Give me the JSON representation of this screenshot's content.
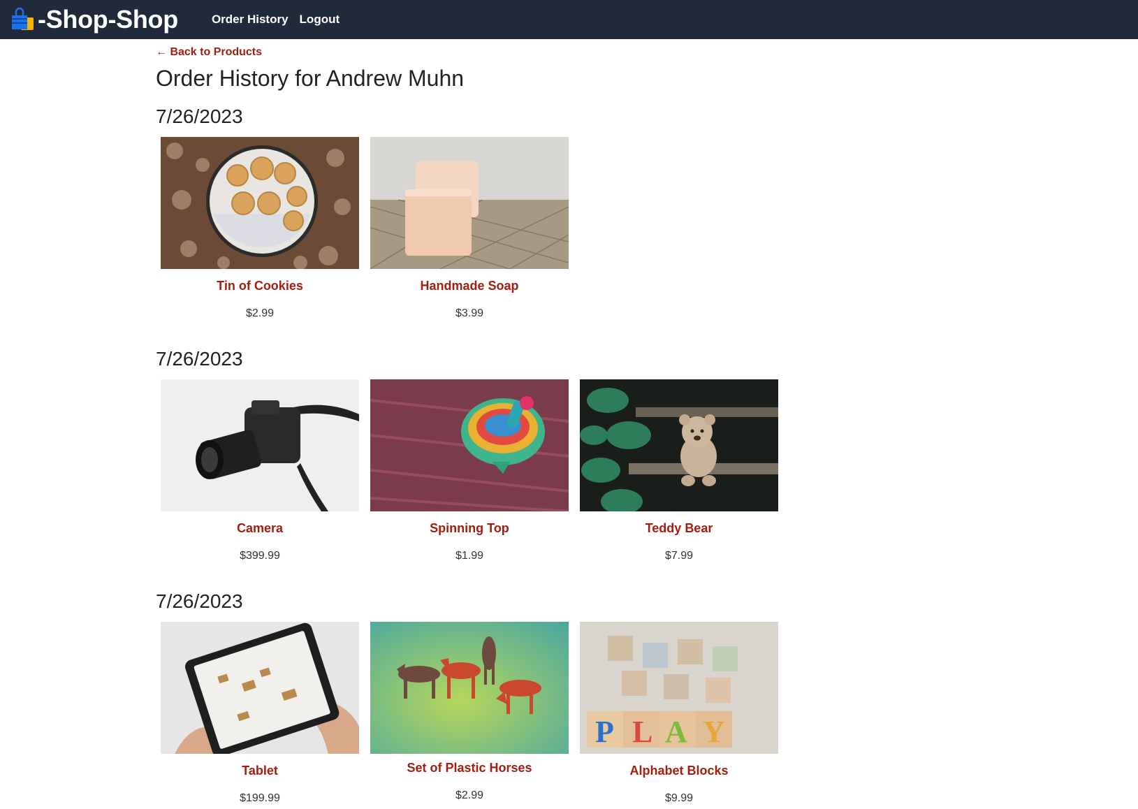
{
  "nav": {
    "brand": "-Shop-Shop",
    "order_history": "Order History",
    "logout": "Logout"
  },
  "back_link": "← Back to Products",
  "title": "Order History for Andrew Muhn",
  "orders": [
    {
      "date": "7/26/2023",
      "products": [
        {
          "name": "Tin of Cookies",
          "price": "$2.99",
          "image": "cookies-tin-photo"
        },
        {
          "name": "Handmade Soap",
          "price": "$3.99",
          "image": "soap-photo"
        }
      ]
    },
    {
      "date": "7/26/2023",
      "products": [
        {
          "name": "Camera",
          "price": "$399.99",
          "image": "camera-photo"
        },
        {
          "name": "Spinning Top",
          "price": "$1.99",
          "image": "spinning-top-photo"
        },
        {
          "name": "Teddy Bear",
          "price": "$7.99",
          "image": "teddy-bear-photo"
        }
      ]
    },
    {
      "date": "7/26/2023",
      "products": [
        {
          "name": "Tablet",
          "price": "$199.99",
          "image": "tablet-photo"
        },
        {
          "name": "Set of Plastic Horses",
          "price": "$2.99",
          "image": "plastic-horses-photo"
        },
        {
          "name": "Alphabet Blocks",
          "price": "$9.99",
          "image": "alphabet-blocks-photo"
        }
      ]
    }
  ],
  "colors": {
    "navbar": "#212a3a",
    "accent": "#a21f10"
  }
}
